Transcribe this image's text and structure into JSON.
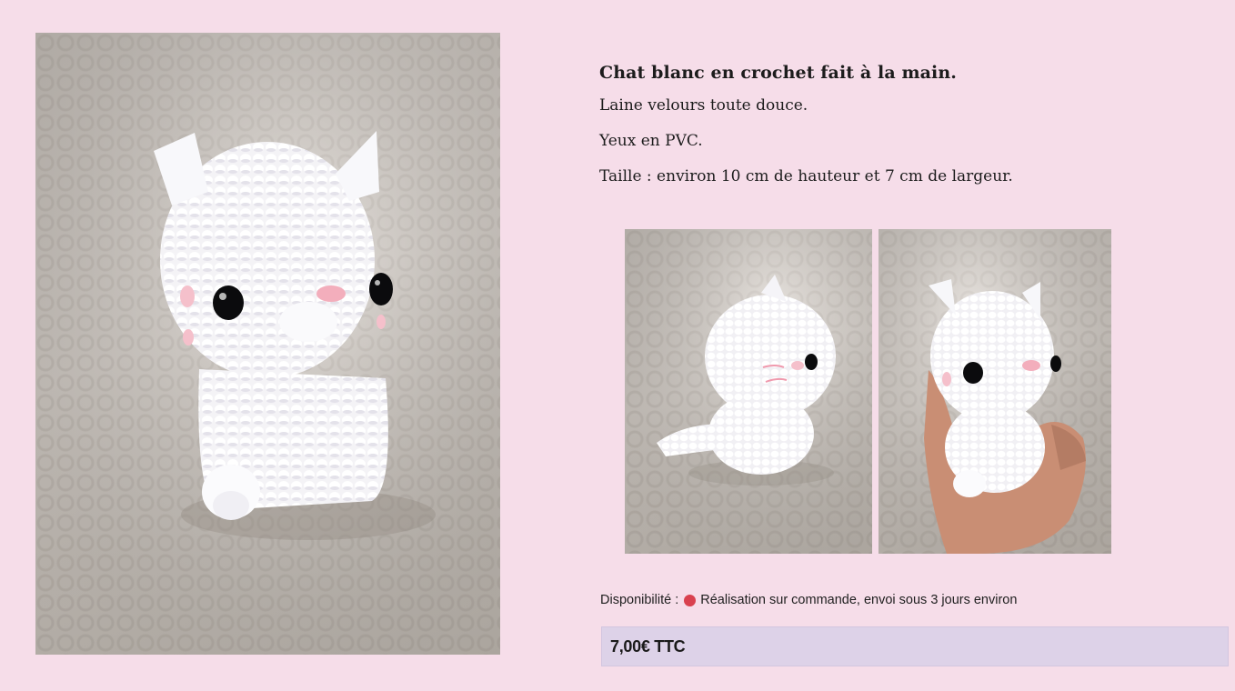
{
  "description": {
    "title": "Chat blanc en crochet fait à la main.",
    "material": "Laine velours toute douce.",
    "eyes": "Yeux en PVC.",
    "size": "Taille : environ 10 cm de hauteur et 7 cm de largeur."
  },
  "availability": {
    "label": "Disponibilité :",
    "status_color": "#d9414f",
    "text": "Réalisation sur commande, envoi sous 3 jours environ"
  },
  "price": {
    "text": "7,00€ TTC"
  },
  "colors": {
    "page_background": "#f6dde9",
    "price_background": "#ddd2e8",
    "status_dot": "#d9414f"
  }
}
